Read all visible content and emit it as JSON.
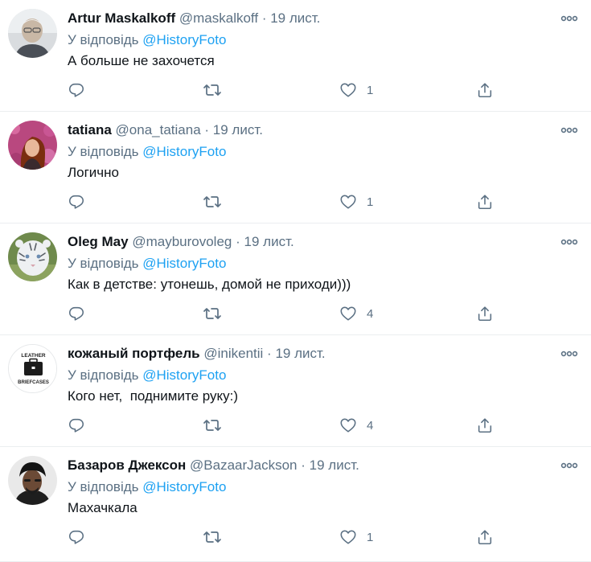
{
  "reply_prefix": "У відповідь",
  "tweets": [
    {
      "name": "Artur Maskalkoff",
      "handle": "@maskalkoff",
      "separator": "·",
      "date": "19 лист.",
      "reply_to": "@HistoryFoto",
      "text": "А больше не захочется",
      "likes": "1",
      "avatar_icon": "user-photo-grey-haired-man"
    },
    {
      "name": "tatiana",
      "handle": "@ona_tatiana",
      "separator": "·",
      "date": "19 лист.",
      "reply_to": "@HistoryFoto",
      "text": "Логично",
      "likes": "1",
      "avatar_icon": "user-photo-woman-flowers"
    },
    {
      "name": "Oleg May",
      "handle": "@mayburovoleg",
      "separator": "·",
      "date": "19 лист.",
      "reply_to": "@HistoryFoto",
      "text": "Как в детстве: утонешь, домой не приходи)))",
      "likes": "4",
      "avatar_icon": "user-photo-white-tiger"
    },
    {
      "name": "кожаный портфель",
      "handle": "@inikentii",
      "separator": "·",
      "date": "19 лист.",
      "reply_to": "@HistoryFoto",
      "text": "Кого нет,  поднимите руку:)",
      "likes": "4",
      "avatar_icon": "briefcase-logo",
      "avatar_text_top": "LEATHER",
      "avatar_text_bottom": "BRIEFCASES"
    },
    {
      "name": "Базаров Джексон",
      "handle": "@BazaarJackson",
      "separator": "·",
      "date": "19 лист.",
      "reply_to": "@HistoryFoto",
      "text": "Махачкала",
      "likes": "1",
      "avatar_icon": "user-photo-man-dark-hat"
    }
  ]
}
